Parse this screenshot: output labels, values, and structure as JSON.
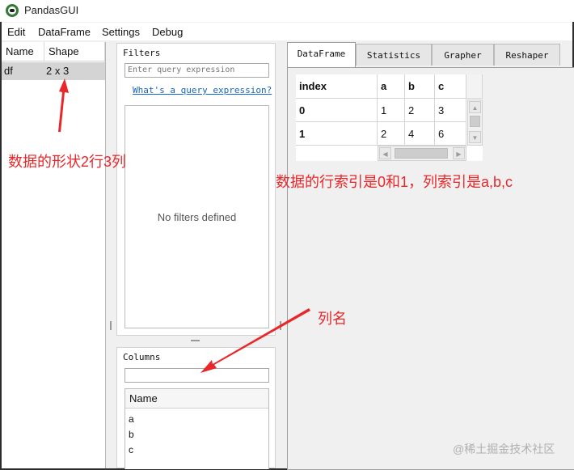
{
  "window": {
    "title": "PandasGUI"
  },
  "menu": {
    "items": [
      "Edit",
      "DataFrame",
      "Settings",
      "Debug"
    ]
  },
  "navigator": {
    "columns": [
      "Name",
      "Shape"
    ],
    "rows": [
      {
        "name": "df",
        "shape": "2 x 3"
      }
    ]
  },
  "filters": {
    "title": "Filters",
    "placeholder": "Enter query expression",
    "link": "What's a query expression?",
    "empty_text": "No filters defined"
  },
  "columns_panel": {
    "title": "Columns",
    "search_value": "",
    "header": "Name",
    "items": [
      "a",
      "b",
      "c"
    ]
  },
  "tabs": [
    "DataFrame",
    "Statistics",
    "Grapher",
    "Reshaper"
  ],
  "active_tab": "DataFrame",
  "dataframe": {
    "index_header": "index",
    "columns": [
      "a",
      "b",
      "c"
    ],
    "rows": [
      {
        "index": "0",
        "values": [
          "1",
          "2",
          "3"
        ]
      },
      {
        "index": "1",
        "values": [
          "2",
          "4",
          "6"
        ]
      }
    ]
  },
  "annotations": {
    "shape_note": "数据的形状2行3列",
    "index_note": "数据的行索引是0和1，列索引是a,b,c",
    "columns_note": "列名",
    "color": "#e8272a"
  },
  "watermark": "@稀土掘金技术社区"
}
